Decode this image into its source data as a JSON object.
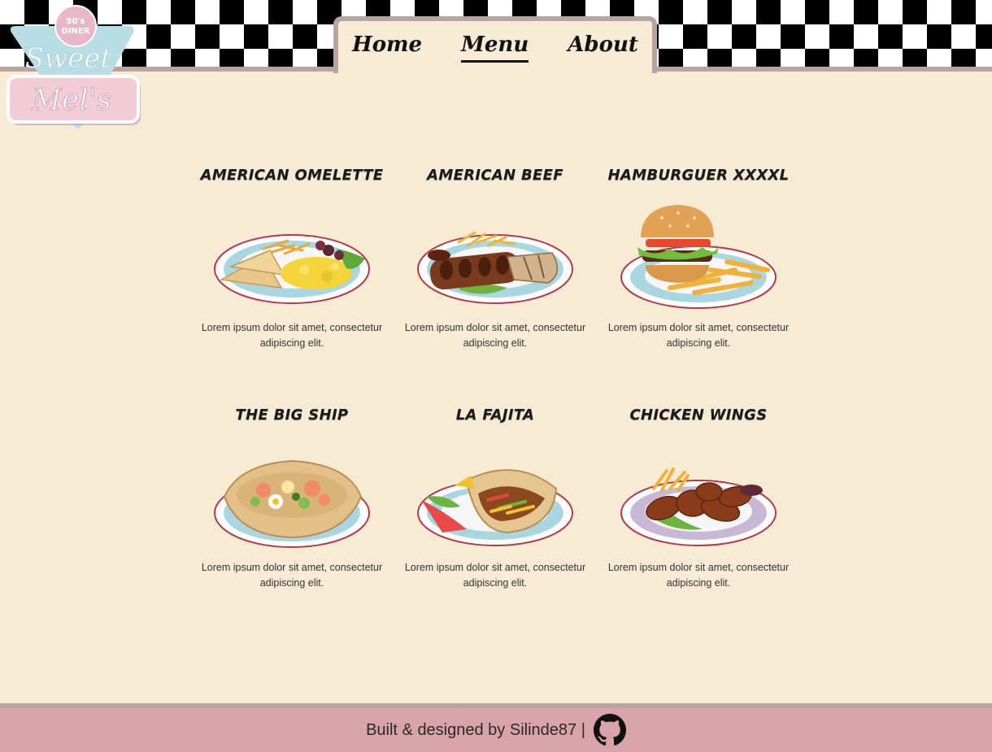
{
  "brand": {
    "badge_line1": "50's",
    "badge_line2": "DINER",
    "name_line1": "Sweet",
    "name_line2": "Mel's",
    "colors": {
      "mint": "#b9dde4",
      "pink": "#e9b8c8",
      "pink_light": "#f2cdd8"
    }
  },
  "nav": {
    "items": [
      {
        "label": "Home",
        "active": false
      },
      {
        "label": "Menu",
        "active": true
      },
      {
        "label": "About",
        "active": false
      }
    ]
  },
  "menu": {
    "items": [
      {
        "title": "AMERICAN OMELETTE",
        "desc": "Lorem ipsum dolor sit amet, consectetur adipiscing elit.",
        "image": "omelette-plate"
      },
      {
        "title": "AMERICAN BEEF",
        "desc": "Lorem ipsum dolor sit amet, consectetur adipiscing elit.",
        "image": "ribs-plate"
      },
      {
        "title": "HAMBURGUER XXXXL",
        "desc": "Lorem ipsum dolor sit amet, consectetur adipiscing elit.",
        "image": "burger-plate"
      },
      {
        "title": "THE BIG SHIP",
        "desc": "Lorem ipsum dolor sit amet, consectetur adipiscing elit.",
        "image": "taco-salad-plate"
      },
      {
        "title": "LA FAJITA",
        "desc": "Lorem ipsum dolor sit amet, consectetur adipiscing elit.",
        "image": "fajita-plate"
      },
      {
        "title": "CHICKEN WINGS",
        "desc": "Lorem ipsum dolor sit amet, consectetur adipiscing elit.",
        "image": "wings-plate"
      }
    ]
  },
  "footer": {
    "text": "Built & designed by Silinde87 |",
    "icon": "github-icon"
  },
  "colors": {
    "background": "#f7ebd5",
    "rule": "#b9a3a3",
    "footer": "#d9a3aa"
  }
}
